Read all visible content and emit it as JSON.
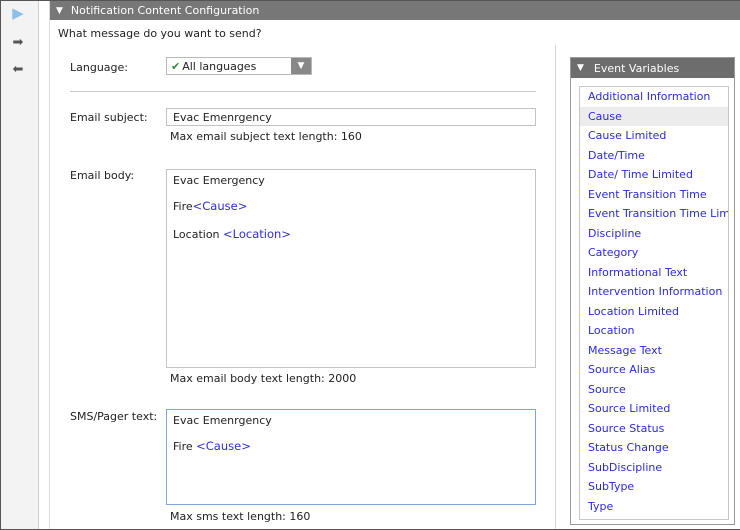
{
  "rail": {
    "expand_icon": "▶",
    "next_icon": "➡",
    "prev_icon": "⬅"
  },
  "header": {
    "caret": "▼",
    "title": "Notification Content Configuration"
  },
  "question": "What message do you want to send?",
  "language": {
    "label": "Language:",
    "check": "✔",
    "value": "All languages",
    "arrow": "▼"
  },
  "email_subject": {
    "label": "Email subject:",
    "value": "Evac Emenrgency",
    "hint": "Max email subject text length: 160"
  },
  "email_body": {
    "label": "Email body:",
    "line1": "Evac Emergency",
    "line2_prefix": "Fire",
    "line2_token": "<Cause>",
    "line3_prefix": "Location ",
    "line3_token": "<Location>",
    "hint": "Max email body text length: 2000"
  },
  "sms": {
    "label": "SMS/Pager text:",
    "line1": "Evac Emenrgency",
    "line2_prefix": "Fire ",
    "line2_token": "<Cause>",
    "hint": "Max sms text length: 160"
  },
  "event_variables": {
    "caret": "▼",
    "title": "Event Variables",
    "selected": "Cause",
    "items": [
      "Additional Information",
      "Cause",
      "Cause Limited",
      "Date/Time",
      "Date/ Time Limited",
      "Event Transition Time",
      "Event Transition Time Limited",
      "Discipline",
      "Category",
      "Informational Text",
      "Intervention Information",
      "Location Limited",
      "Location",
      "Message Text",
      "Source Alias",
      "Source",
      "Source Limited",
      "Source Status",
      "Status Change",
      "SubDiscipline",
      "SubType",
      "Type"
    ]
  },
  "colors": {
    "header_bg": "#777777",
    "link_blue": "#2b2bd2",
    "check_green": "#2e8b3a",
    "focus_border": "#7fa7d8"
  }
}
